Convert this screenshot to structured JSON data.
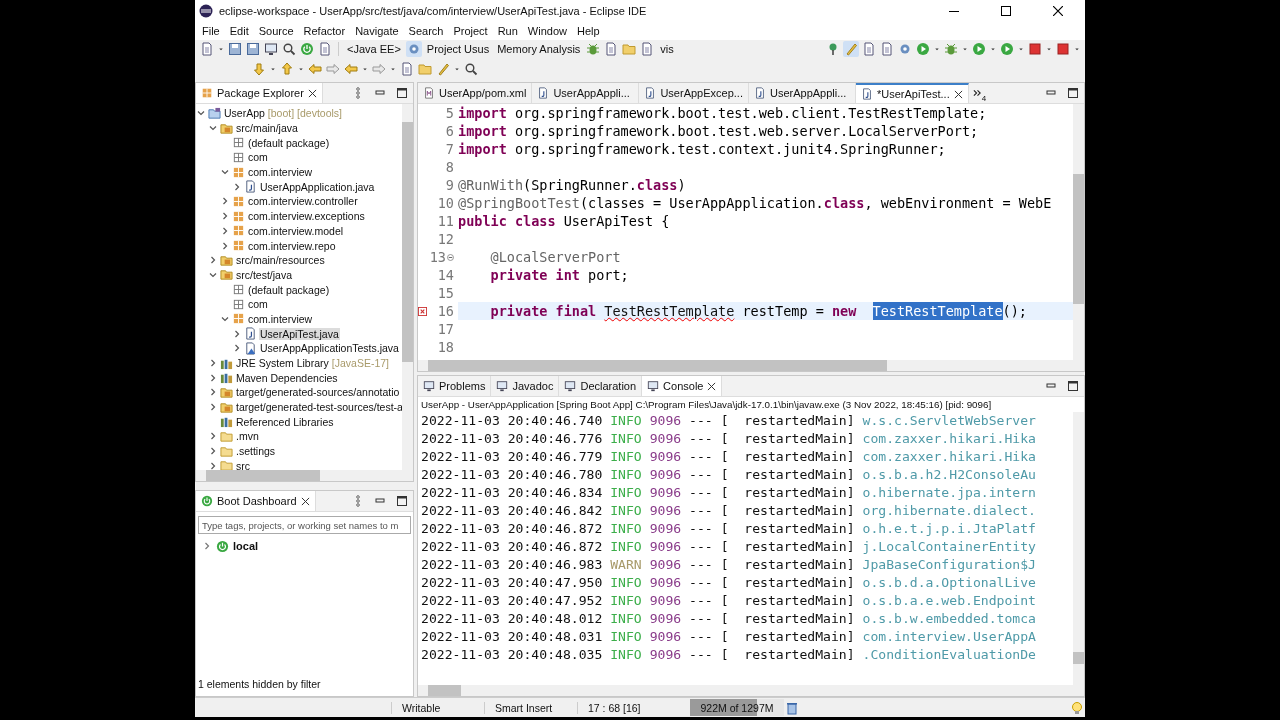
{
  "window": {
    "title": "eclipse-workspace - UserApp/src/test/java/com/interview/UserApiTest.java - Eclipse IDE"
  },
  "menu": [
    "File",
    "Edit",
    "Source",
    "Refactor",
    "Navigate",
    "Search",
    "Project",
    "Run",
    "Window",
    "Help"
  ],
  "toolbar": {
    "perspectives": [
      "<Java EE>",
      "Project Usus",
      "Memory Analysis"
    ],
    "extra_label": "vis"
  },
  "package_explorer": {
    "title": "Package Explorer",
    "items": [
      {
        "label": "UserApp",
        "decoration": "[boot] [devtools]",
        "kind": "project",
        "expanded": true,
        "selected": false,
        "children": [
          {
            "label": "src/main/java",
            "kind": "source-folder",
            "expanded": true,
            "selected": false,
            "children": [
              {
                "label": "(default package)",
                "kind": "empty-package",
                "selected": false
              },
              {
                "label": "com",
                "kind": "empty-package",
                "selected": false
              },
              {
                "label": "com.interview",
                "kind": "package",
                "expanded": true,
                "selected": false,
                "children": [
                  {
                    "label": "UserAppApplication.java",
                    "kind": "java-file",
                    "expanded": false,
                    "selected": false
                  }
                ]
              },
              {
                "label": "com.interview.controller",
                "kind": "package",
                "expanded": false,
                "selected": false
              },
              {
                "label": "com.interview.exceptions",
                "kind": "package",
                "expanded": false,
                "selected": false
              },
              {
                "label": "com.interview.model",
                "kind": "package",
                "expanded": false,
                "selected": false
              },
              {
                "label": "com.interview.repo",
                "kind": "package",
                "expanded": false,
                "selected": false
              }
            ]
          },
          {
            "label": "src/main/resources",
            "kind": "source-folder",
            "expanded": false,
            "selected": false
          },
          {
            "label": "src/test/java",
            "kind": "source-folder",
            "expanded": true,
            "selected": false,
            "children": [
              {
                "label": "(default package)",
                "kind": "empty-package",
                "selected": false
              },
              {
                "label": "com",
                "kind": "empty-package",
                "selected": false
              },
              {
                "label": "com.interview",
                "kind": "package",
                "expanded": true,
                "selected": false,
                "children": [
                  {
                    "label": "UserApiTest.java",
                    "kind": "java-file",
                    "expanded": false,
                    "selected": true
                  },
                  {
                    "label": "UserAppApplicationTests.java",
                    "kind": "test-file",
                    "expanded": false,
                    "selected": false
                  }
                ]
              }
            ]
          },
          {
            "label": "JRE System Library",
            "decoration": "[JavaSE-17]",
            "kind": "library",
            "expanded": false,
            "selected": false
          },
          {
            "label": "Maven Dependencies",
            "kind": "library",
            "expanded": false,
            "selected": false
          },
          {
            "label": "target/generated-sources/annotatio",
            "kind": "source-folder",
            "expanded": false,
            "selected": false
          },
          {
            "label": "target/generated-test-sources/test-a",
            "kind": "source-folder",
            "expanded": false,
            "selected": false
          },
          {
            "label": "Referenced Libraries",
            "kind": "library",
            "selected": false
          },
          {
            "label": ".mvn",
            "kind": "folder",
            "expanded": false,
            "selected": false
          },
          {
            "label": ".settings",
            "kind": "folder",
            "expanded": false,
            "selected": false
          },
          {
            "label": "src",
            "kind": "folder",
            "expanded": false,
            "selected": false
          }
        ]
      }
    ]
  },
  "boot_dashboard": {
    "title": "Boot Dashboard",
    "filter_placeholder": "Type tags, projects, or working set names to m",
    "items": [
      {
        "label": "local",
        "expanded": false
      }
    ],
    "footer": "1 elements hidden by filter"
  },
  "editor": {
    "tabs": [
      {
        "label": "UserApp/pom.xml",
        "kind": "xml",
        "selected": false
      },
      {
        "label": "UserAppAppli...",
        "kind": "java",
        "selected": false
      },
      {
        "label": "UserAppExcep...",
        "kind": "java",
        "selected": false
      },
      {
        "label": "UserAppAppli...",
        "kind": "java",
        "selected": false
      },
      {
        "label": "*UserApiTest...",
        "kind": "java",
        "selected": true
      }
    ],
    "overflow_count": "4",
    "lines": [
      {
        "number": "5",
        "current": false,
        "error": false,
        "foldable": false,
        "tokens": [
          {
            "kind": "keyword",
            "text": "import "
          },
          {
            "kind": "plain",
            "text": "org.springframework.boot.test.web.client.TestRestTemplate;"
          }
        ]
      },
      {
        "number": "6",
        "current": false,
        "error": false,
        "foldable": false,
        "tokens": [
          {
            "kind": "keyword",
            "text": "import "
          },
          {
            "kind": "plain",
            "text": "org.springframework.boot.test.web.server.LocalServerPort;"
          }
        ]
      },
      {
        "number": "7",
        "current": false,
        "error": false,
        "foldable": false,
        "tokens": [
          {
            "kind": "keyword",
            "text": "import "
          },
          {
            "kind": "plain",
            "text": "org.springframework.test.context.junit4.SpringRunner;"
          }
        ]
      },
      {
        "number": "8",
        "current": false,
        "error": false,
        "foldable": false
      },
      {
        "number": "9",
        "current": false,
        "error": false,
        "foldable": false,
        "tokens": [
          {
            "kind": "annotation",
            "text": "@RunWith"
          },
          {
            "kind": "plain",
            "text": "(SpringRunner."
          },
          {
            "kind": "keyword",
            "text": "class"
          },
          {
            "kind": "plain",
            "text": ")"
          }
        ]
      },
      {
        "number": "10",
        "current": false,
        "error": false,
        "foldable": false,
        "tokens": [
          {
            "kind": "annotation",
            "text": "@SpringBootTest"
          },
          {
            "kind": "plain",
            "text": "(classes = UserAppApplication."
          },
          {
            "kind": "keyword",
            "text": "class"
          },
          {
            "kind": "plain",
            "text": ", webEnvironment = WebE"
          }
        ]
      },
      {
        "number": "11",
        "current": false,
        "error": false,
        "foldable": false,
        "tokens": [
          {
            "kind": "keyword",
            "text": "public class "
          },
          {
            "kind": "plain",
            "text": "UserApiTest {"
          }
        ]
      },
      {
        "number": "12",
        "current": false,
        "error": false,
        "foldable": false
      },
      {
        "number": "13",
        "current": false,
        "error": false,
        "foldable": true,
        "tokens": [
          {
            "kind": "annotation",
            "text": "    @LocalServerPort"
          }
        ]
      },
      {
        "number": "14",
        "current": false,
        "error": false,
        "foldable": false,
        "tokens": [
          {
            "kind": "keyword",
            "text": "    private int"
          },
          {
            "kind": "plain",
            "text": " port;"
          }
        ]
      },
      {
        "number": "15",
        "current": false,
        "error": false,
        "foldable": false
      },
      {
        "number": "16",
        "current": true,
        "error": true,
        "foldable": false,
        "tokens": [
          {
            "kind": "keyword",
            "text": "    private final "
          },
          {
            "kind": "error",
            "text": "TestRestTemplate"
          },
          {
            "kind": "plain",
            "text": " restTemp = "
          },
          {
            "kind": "keyword",
            "text": "new  "
          },
          {
            "kind": "selected",
            "text": "TestRestTemplate"
          },
          {
            "kind": "plain",
            "text": "();"
          }
        ]
      },
      {
        "number": "17",
        "current": false,
        "error": false,
        "foldable": false
      },
      {
        "number": "18",
        "current": false,
        "error": false,
        "foldable": false
      }
    ]
  },
  "console": {
    "tabs": [
      {
        "label": "Problems",
        "selected": false
      },
      {
        "label": "Javadoc",
        "selected": false
      },
      {
        "label": "Declaration",
        "selected": false
      },
      {
        "label": "Console",
        "selected": true
      }
    ],
    "header": "UserApp - UserAppApplication [Spring Boot App] C:\\Program Files\\Java\\jdk-17.0.1\\bin\\javaw.exe  (3 Nov 2022, 18:45:16) [pid: 9096]",
    "rows": [
      {
        "timestamp": "2022-11-03 20:40:46.740",
        "level": "INFO",
        "pid": "9096",
        "separator": "---",
        "thread": "[  restartedMain]",
        "logger": "w.s.c.ServletWebServer"
      },
      {
        "timestamp": "2022-11-03 20:40:46.776",
        "level": "INFO",
        "pid": "9096",
        "separator": "---",
        "thread": "[  restartedMain]",
        "logger": "com.zaxxer.hikari.Hika"
      },
      {
        "timestamp": "2022-11-03 20:40:46.779",
        "level": "INFO",
        "pid": "9096",
        "separator": "---",
        "thread": "[  restartedMain]",
        "logger": "com.zaxxer.hikari.Hika"
      },
      {
        "timestamp": "2022-11-03 20:40:46.780",
        "level": "INFO",
        "pid": "9096",
        "separator": "---",
        "thread": "[  restartedMain]",
        "logger": "o.s.b.a.h2.H2ConsoleAu"
      },
      {
        "timestamp": "2022-11-03 20:40:46.834",
        "level": "INFO",
        "pid": "9096",
        "separator": "---",
        "thread": "[  restartedMain]",
        "logger": "o.hibernate.jpa.intern"
      },
      {
        "timestamp": "2022-11-03 20:40:46.842",
        "level": "INFO",
        "pid": "9096",
        "separator": "---",
        "thread": "[  restartedMain]",
        "logger": "org.hibernate.dialect."
      },
      {
        "timestamp": "2022-11-03 20:40:46.872",
        "level": "INFO",
        "pid": "9096",
        "separator": "---",
        "thread": "[  restartedMain]",
        "logger": "o.h.e.t.j.p.i.JtaPlatf"
      },
      {
        "timestamp": "2022-11-03 20:40:46.872",
        "level": "INFO",
        "pid": "9096",
        "separator": "---",
        "thread": "[  restartedMain]",
        "logger": "j.LocalContainerEntity"
      },
      {
        "timestamp": "2022-11-03 20:40:46.983",
        "level": "WARN",
        "pid": "9096",
        "separator": "---",
        "thread": "[  restartedMain]",
        "logger": "JpaBaseConfiguration$J"
      },
      {
        "timestamp": "2022-11-03 20:40:47.950",
        "level": "INFO",
        "pid": "9096",
        "separator": "---",
        "thread": "[  restartedMain]",
        "logger": "o.s.b.d.a.OptionalLive"
      },
      {
        "timestamp": "2022-11-03 20:40:47.952",
        "level": "INFO",
        "pid": "9096",
        "separator": "---",
        "thread": "[  restartedMain]",
        "logger": "o.s.b.a.e.web.Endpoint"
      },
      {
        "timestamp": "2022-11-03 20:40:48.012",
        "level": "INFO",
        "pid": "9096",
        "separator": "---",
        "thread": "[  restartedMain]",
        "logger": "o.s.b.w.embedded.tomca"
      },
      {
        "timestamp": "2022-11-03 20:40:48.031",
        "level": "INFO",
        "pid": "9096",
        "separator": "---",
        "thread": "[  restartedMain]",
        "logger": "com.interview.UserAppA"
      },
      {
        "timestamp": "2022-11-03 20:40:48.035",
        "level": "INFO",
        "pid": "9096",
        "separator": "---",
        "thread": "[  restartedMain]",
        "logger": ".ConditionEvaluationDe"
      }
    ]
  },
  "status_bar": {
    "fields": [
      "Writable",
      "Smart Insert",
      "17 : 68 [16]"
    ],
    "heap": {
      "label": "922M of 1297M",
      "level": 0.71
    }
  }
}
